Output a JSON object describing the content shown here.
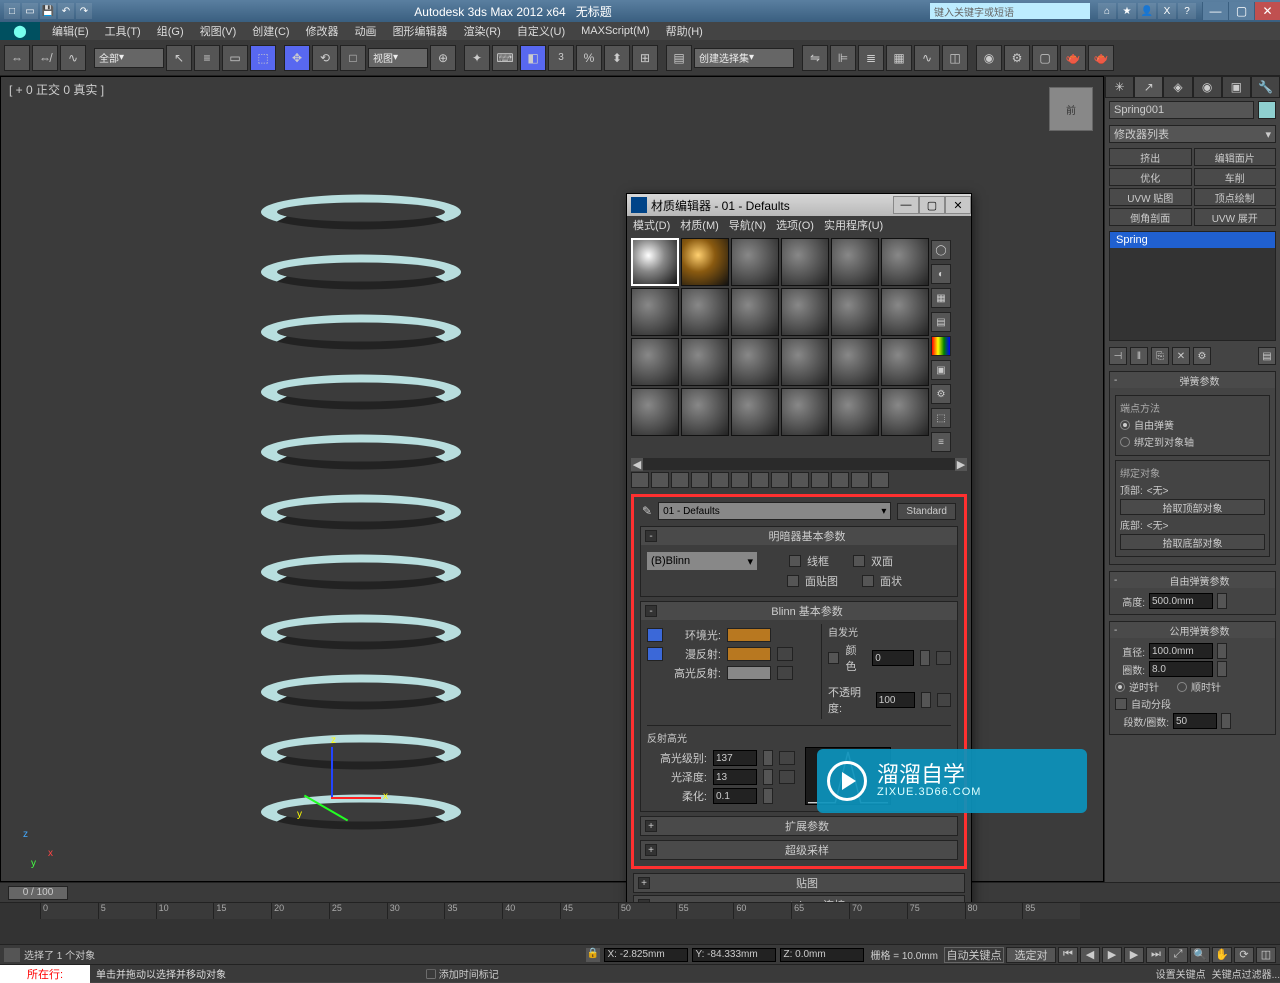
{
  "app": {
    "title": "Autodesk 3ds Max 2012 x64",
    "doc": "无标题",
    "search_placeholder": "键入关键字或短语"
  },
  "menu": [
    "编辑(E)",
    "工具(T)",
    "组(G)",
    "视图(V)",
    "创建(C)",
    "修改器",
    "动画",
    "图形编辑器",
    "渲染(R)",
    "自定义(U)",
    "MAXScript(M)",
    "帮助(H)"
  ],
  "toolbar": {
    "selset_combo": "全部",
    "view_combo": "视图",
    "named_sel": "创建选择集"
  },
  "viewport": {
    "label": "[ + 0 正交 0 真实 ]",
    "cube": "前"
  },
  "material_editor": {
    "title": "材质编辑器 - 01 - Defaults",
    "menu": [
      "模式(D)",
      "材质(M)",
      "导航(N)",
      "选项(O)",
      "实用程序(U)"
    ],
    "mat_name": "01 - Defaults",
    "mat_type": "Standard",
    "rollouts": {
      "shader": {
        "title": "明暗器基本参数",
        "shader_name": "(B)Blinn",
        "opts": {
          "wire": "线框",
          "two_sided": "双面",
          "face_map": "面贴图",
          "faceted": "面状"
        }
      },
      "blinn": {
        "title": "Blinn 基本参数",
        "ambient": "环境光:",
        "diffuse": "漫反射:",
        "specular": "高光反射:",
        "self_illum": "自发光",
        "color_chk": "颜色",
        "color_val": "0",
        "opacity_lbl": "不透明度:",
        "opacity_val": "100",
        "spec_section": "反射高光",
        "spec_level_lbl": "高光级别:",
        "spec_level_val": "137",
        "gloss_lbl": "光泽度:",
        "gloss_val": "13",
        "soften_lbl": "柔化:",
        "soften_val": "0.1"
      },
      "extended": "扩展参数",
      "supersample": "超级采样",
      "maps": "贴图",
      "mentalray": "mental ray 连接"
    }
  },
  "cmdpanel": {
    "obj_name": "Spring001",
    "mod_list_lbl": "修改器列表",
    "mod_buttons": [
      "挤出",
      "编辑面片",
      "优化",
      "车削",
      "UVW 贴图",
      "顶点绘制",
      "倒角剖面",
      "UVW 展开"
    ],
    "stack_item": "Spring",
    "rollouts": {
      "spring": {
        "title": "弹簧参数",
        "end_method": "端点方法",
        "free": "自由弹簧",
        "bound": "绑定到对象轴",
        "bind_obj": "绑定对象",
        "top_lbl": "顶部:",
        "none": "<无>",
        "pick_top": "拾取顶部对象",
        "bottom_lbl": "底部:",
        "pick_bottom": "拾取底部对象"
      },
      "free": {
        "title": "自由弹簧参数",
        "height_lbl": "高度:",
        "height_val": "500.0mm"
      },
      "common": {
        "title": "公用弹簧参数",
        "diameter_lbl": "直径:",
        "diameter_val": "100.0mm",
        "turns_lbl": "圈数:",
        "turns_val": "8.0",
        "ccw": "逆时针",
        "cw": "顺时针",
        "auto_seg": "自动分段",
        "seg_lbl": "段数/圈数:",
        "seg_val": "50"
      }
    }
  },
  "timeline": {
    "thumb": "0 / 100",
    "ticks": [
      "0",
      "5",
      "10",
      "15",
      "20",
      "25",
      "30",
      "35",
      "40",
      "45",
      "50",
      "55",
      "60",
      "65",
      "70",
      "75",
      "80",
      "85"
    ]
  },
  "status": {
    "selected": "选择了 1 个对象",
    "x": "X: -2.825mm",
    "y": "Y: -84.333mm",
    "z": "Z: 0.0mm",
    "grid": "栅格 = 10.0mm",
    "autokey": "自动关键点",
    "selkey": "选定对",
    "setkey": "设置关键点",
    "keyfilter": "关键点过滤器...",
    "addtag": "添加时间标记"
  },
  "prompt": {
    "mx_label": "所在行:",
    "tip": "单击并拖动以选择并移动对象"
  },
  "watermark": {
    "brand": "溜溜自学",
    "url": "ZIXUE.3D66.COM"
  }
}
